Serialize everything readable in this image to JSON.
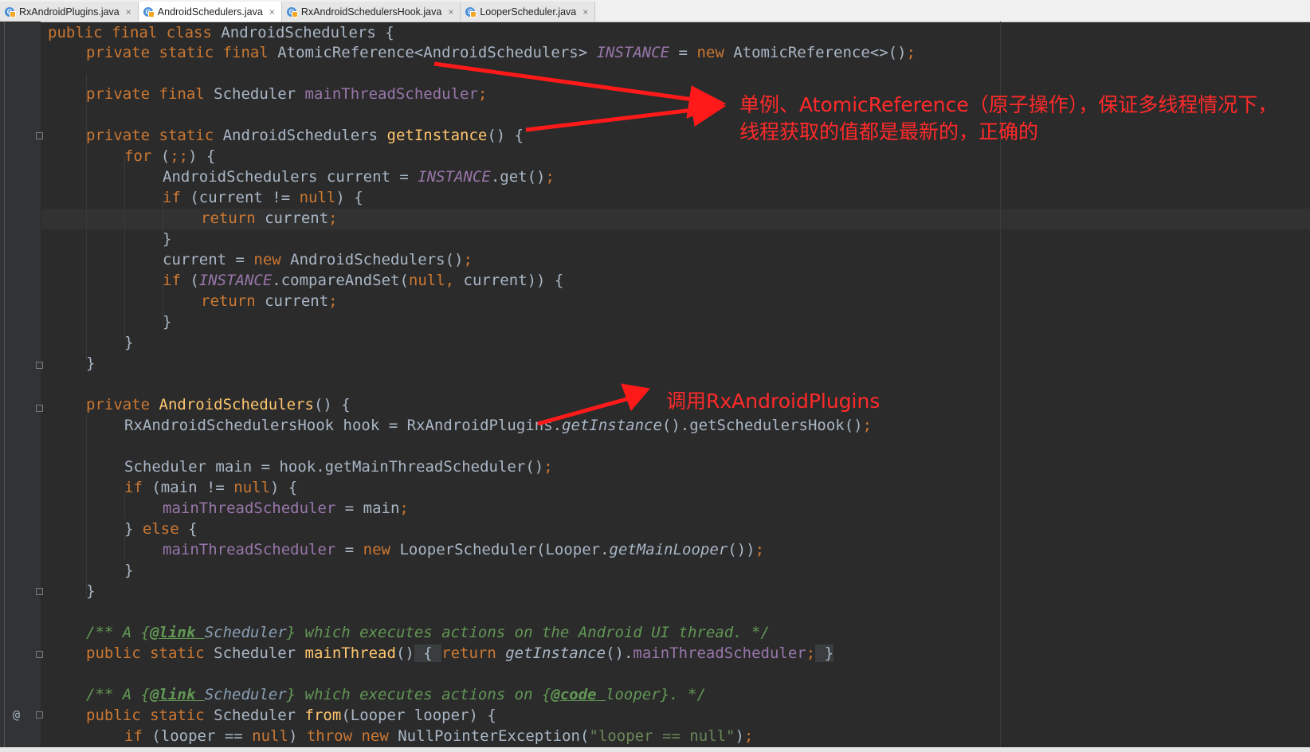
{
  "tabs": [
    {
      "label": "RxAndroidPlugins.java",
      "active": false
    },
    {
      "label": "AndroidSchedulers.java",
      "active": true
    },
    {
      "label": "RxAndroidSchedulersHook.java",
      "active": false
    },
    {
      "label": "LooperScheduler.java",
      "active": false
    }
  ],
  "tab_close_glyph": "×",
  "file_icon_letter": "C",
  "gutter_at_symbol": "@",
  "code": {
    "l1": [
      "public final class ",
      "AndroidSchedulers {"
    ],
    "l2": [
      "private static final ",
      "AtomicReference<AndroidSchedulers> ",
      "INSTANCE",
      " = ",
      "new ",
      "AtomicReference<>()",
      ";"
    ],
    "l4": [
      "private final ",
      "Scheduler ",
      "mainThreadScheduler",
      ";"
    ],
    "l6": [
      "private static ",
      "AndroidSchedulers ",
      "getInstance",
      "() {"
    ],
    "l7": [
      "for ",
      "(",
      ";;",
      ") {"
    ],
    "l8": [
      "AndroidSchedulers current = ",
      "INSTANCE",
      ".get()",
      ";"
    ],
    "l9": [
      "if ",
      "(current != ",
      "null",
      ") {"
    ],
    "l10": [
      "return ",
      "current",
      ";"
    ],
    "l11": "}",
    "l12": [
      "current = ",
      "new ",
      "AndroidSchedulers()",
      ";"
    ],
    "l13": [
      "if ",
      "(",
      "INSTANCE",
      ".compareAndSet(",
      "null",
      ", ",
      "current)) {"
    ],
    "l14": [
      "return ",
      "current",
      ";"
    ],
    "l15": "}",
    "l16": "}",
    "l17": "}",
    "l19": [
      "private ",
      "AndroidSchedulers",
      "() {"
    ],
    "l20": [
      "RxAndroidSchedulersHook hook = RxAndroidPlugins.",
      "getInstance",
      "().getSchedulersHook()",
      ";"
    ],
    "l22": [
      "Scheduler main = hook.getMainThreadScheduler()",
      ";"
    ],
    "l23": [
      "if ",
      "(main != ",
      "null",
      ") {"
    ],
    "l24": [
      "mainThreadScheduler",
      " = main",
      ";"
    ],
    "l25": [
      "} ",
      "else ",
      "{"
    ],
    "l26": [
      "mainThreadScheduler",
      " = ",
      "new ",
      "LooperScheduler(Looper.",
      "getMainLooper",
      "())",
      ";"
    ],
    "l27": "}",
    "l28": "}",
    "l30": [
      "/** A {",
      "@link ",
      "Scheduler",
      "} which executes actions on the Android UI thread. */"
    ],
    "l31": [
      "public static ",
      "Scheduler ",
      "mainThread",
      "()",
      " { ",
      "return ",
      "getInstance",
      "().",
      "mainThreadScheduler",
      ";",
      " }"
    ],
    "l33": [
      "/** A {",
      "@link ",
      "Scheduler",
      "} which executes actions on {",
      "@code ",
      "looper",
      "}. */"
    ],
    "l34": [
      "public static ",
      "Scheduler ",
      "from",
      "(Looper looper) {"
    ],
    "l35": [
      "if ",
      "(looper == ",
      "null",
      ") ",
      "throw new ",
      "NullPointerException(",
      "\"looper == null\"",
      ")",
      ";"
    ]
  },
  "annotations": {
    "a1_line1": "单例、AtomicReference（原子操作），保证多线程情况下，",
    "a1_line2": "线程获取的值都是最新的，正确的",
    "a2": "调用RxAndroidPlugins"
  },
  "colors": {
    "editor_bg": "#2b2b2b",
    "keyword": "#cc7832",
    "field": "#9876aa",
    "method": "#ffc66d",
    "comment": "#629755",
    "string": "#6a8759",
    "default": "#a9b7c6",
    "annotation": "#ff2a2a"
  }
}
